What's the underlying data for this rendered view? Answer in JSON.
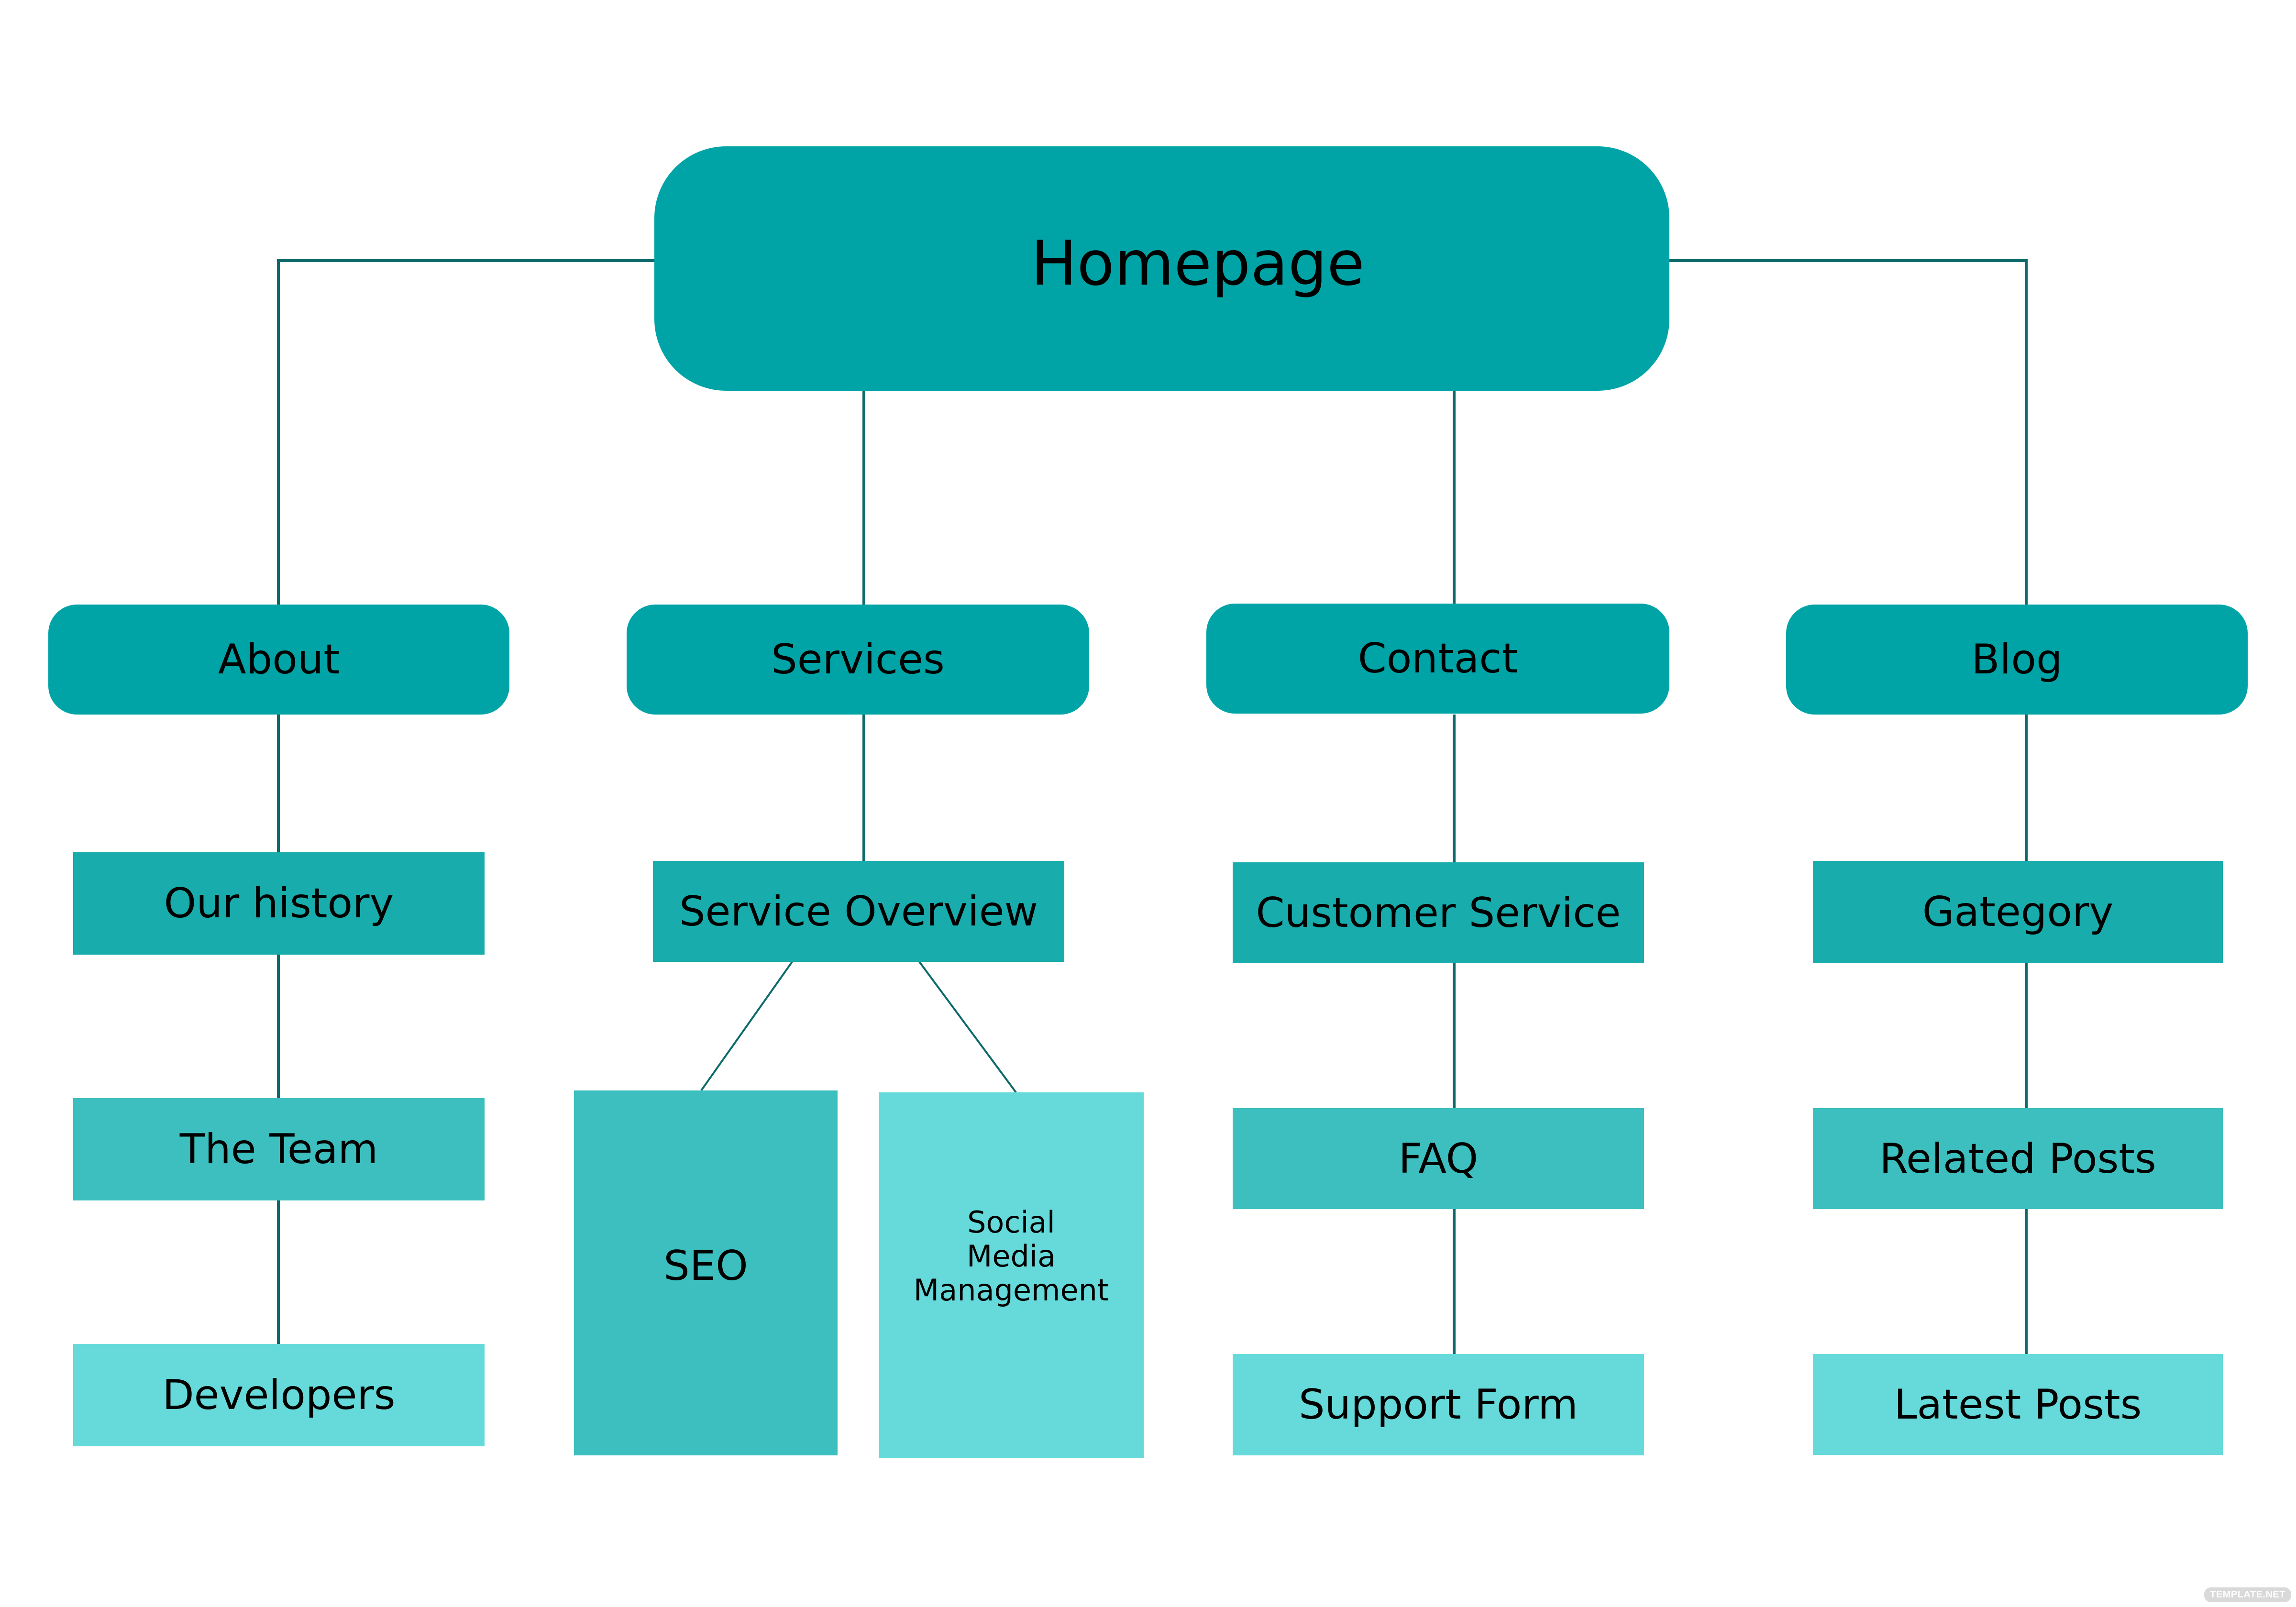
{
  "colors": {
    "root_fill": "#00A4A6",
    "level1_fill": "#00A4A6",
    "level2_fill": "#18ACAC",
    "level3_fill": "#3DBFBF",
    "level4_fill": "#66DADA",
    "connector": "#0E6A6A",
    "text": "#000000"
  },
  "root": {
    "label": "Homepage"
  },
  "branches": [
    {
      "label": "About",
      "children": [
        "Our history",
        "The Team",
        "Developers"
      ]
    },
    {
      "label": "Services",
      "children": [
        "Service Overview"
      ],
      "grandchildren": [
        "SEO",
        "Social\nMedia\nManagement"
      ]
    },
    {
      "label": "Contact",
      "children": [
        "Customer Service",
        "FAQ",
        "Support Form"
      ]
    },
    {
      "label": "Blog",
      "children": [
        "Gategory",
        "Related Posts",
        "Latest Posts"
      ]
    }
  ],
  "watermark": "TEMPLATE.NET"
}
